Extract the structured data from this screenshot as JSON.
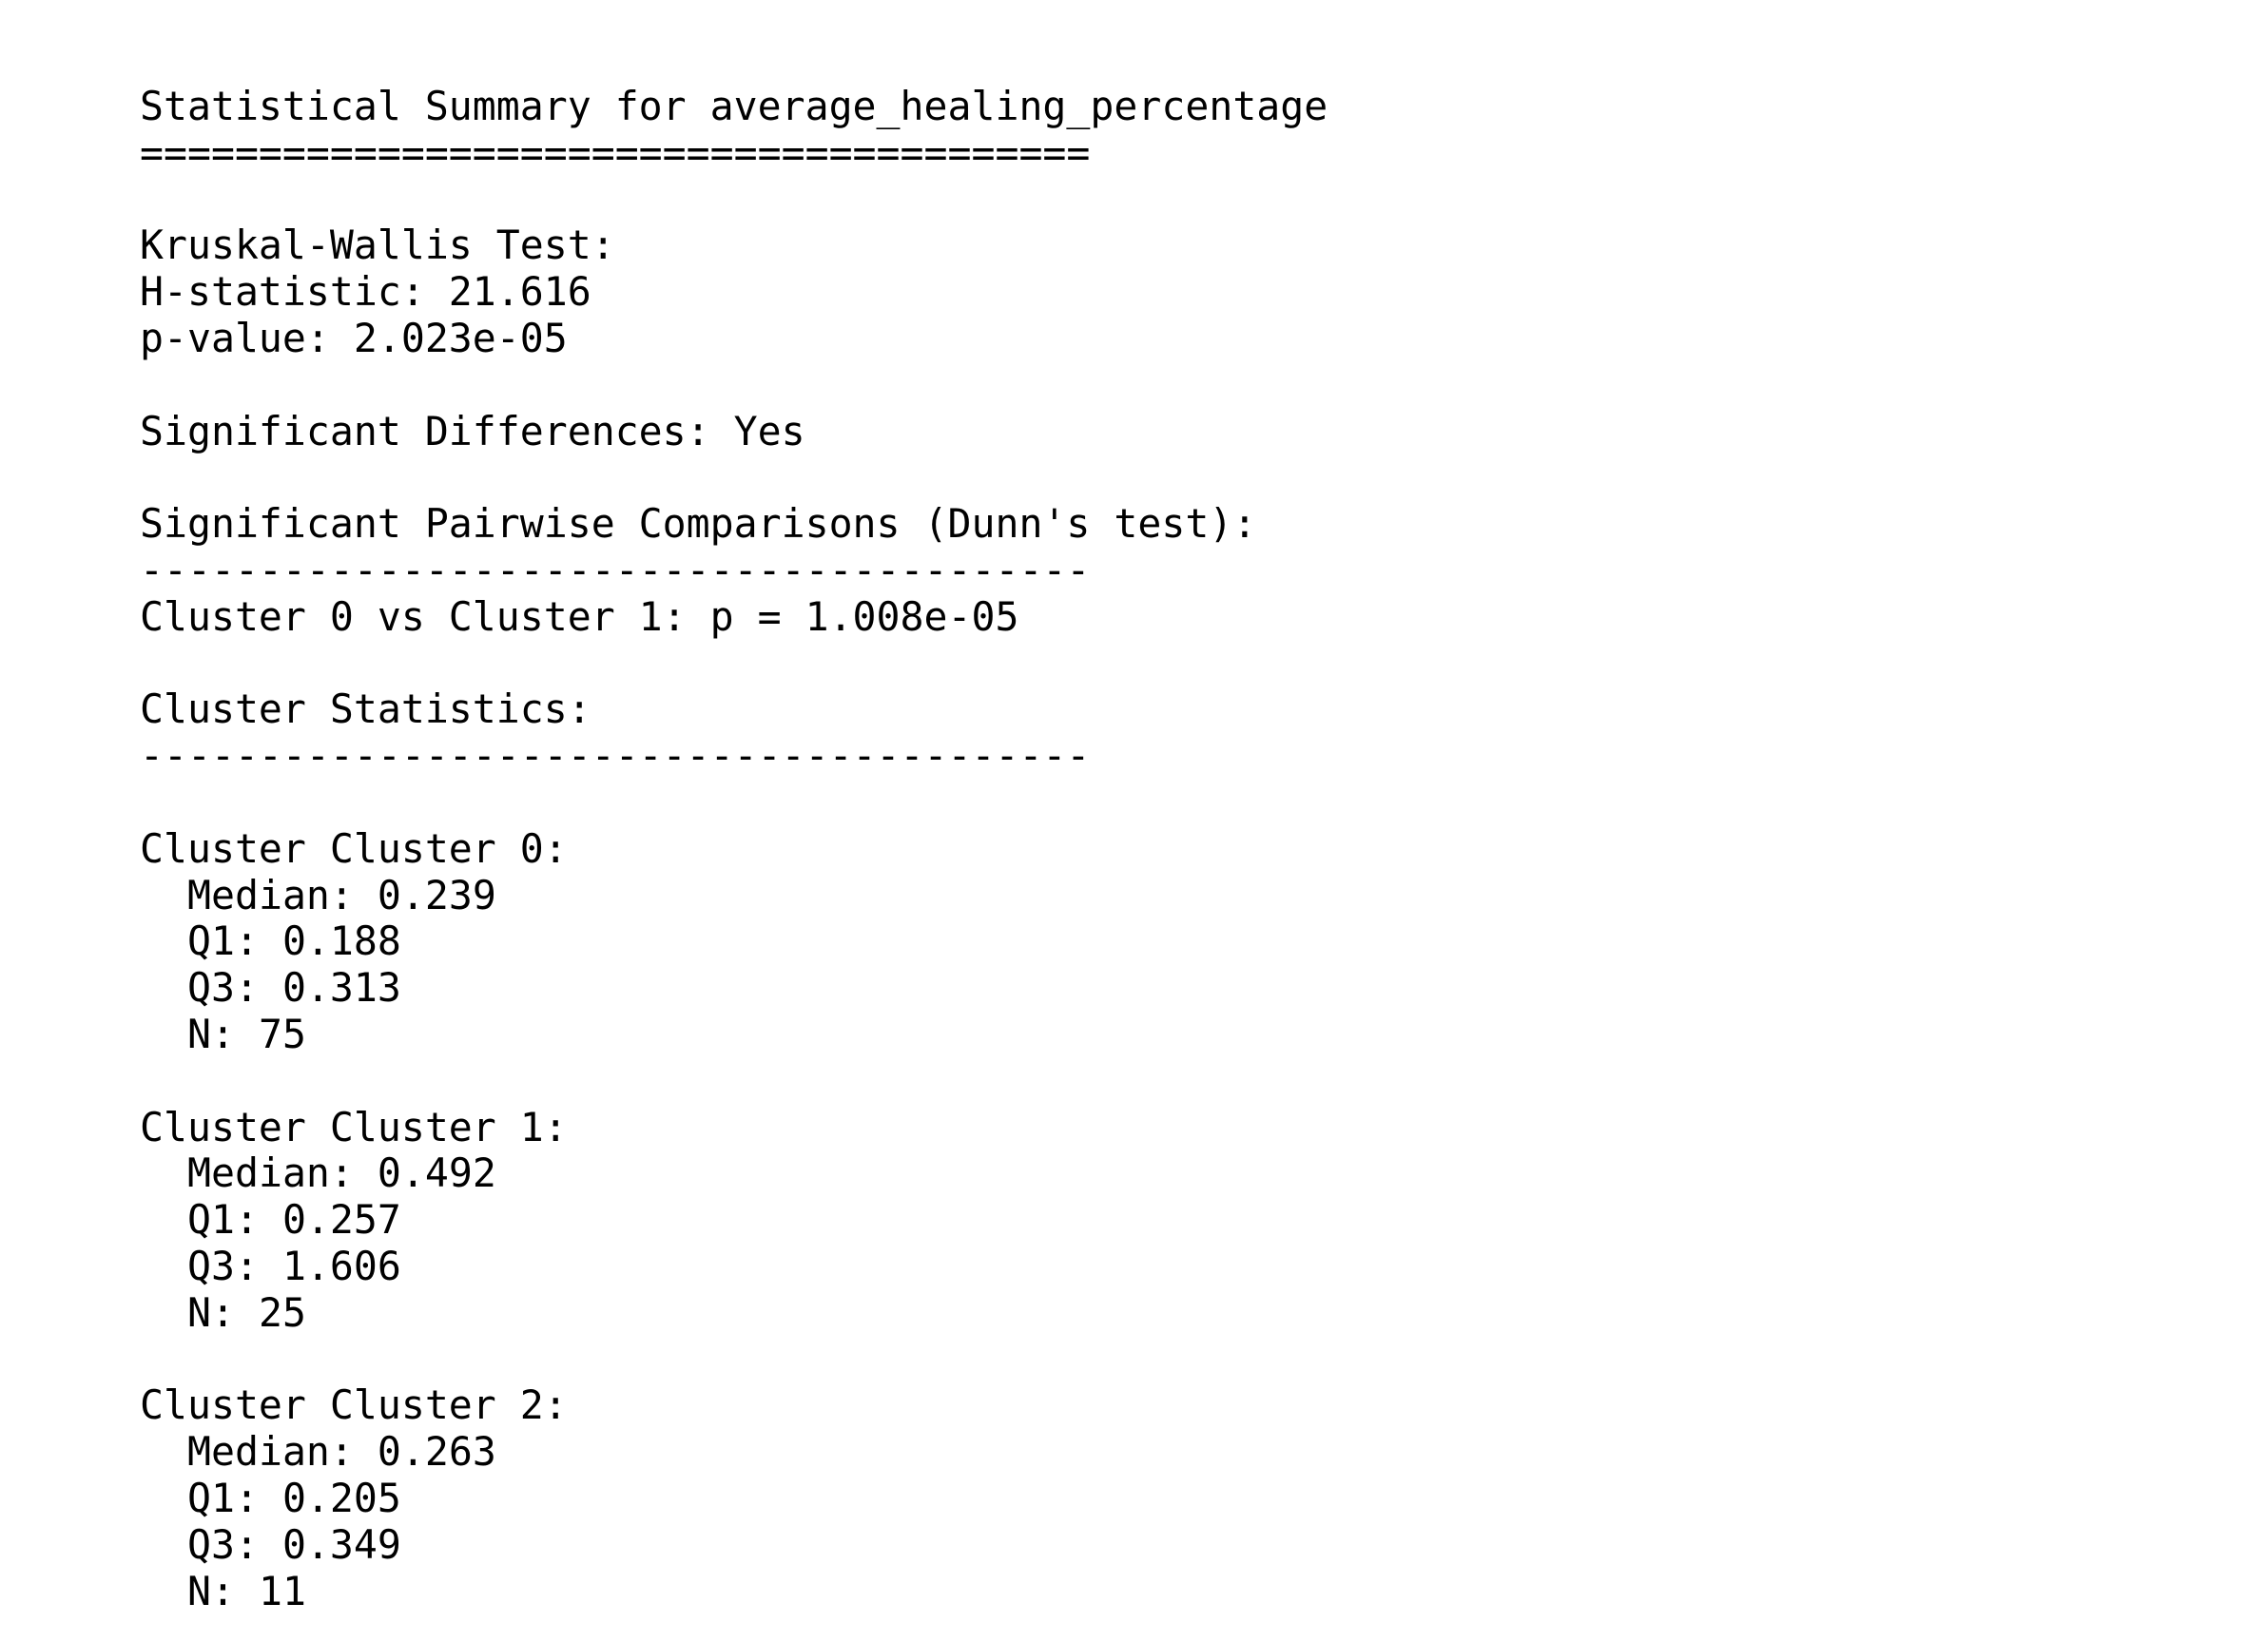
{
  "title": "Statistical Summary for average_healing_percentage",
  "title_rule": "========================================",
  "kruskal_wallis": {
    "heading": "Kruskal-Wallis Test:",
    "h_statistic": "H-statistic: 21.616",
    "p_value": "p-value: 2.023e-05"
  },
  "significance": "Significant Differences: Yes",
  "pairwise": {
    "heading": "Significant Pairwise Comparisons (Dunn's test):",
    "rule": "----------------------------------------",
    "comparisons": [
      "Cluster 0 vs Cluster 1: p = 1.008e-05"
    ]
  },
  "cluster_statistics": {
    "heading": "Cluster Statistics:",
    "rule": "----------------------------------------",
    "clusters": [
      {
        "name": "Cluster Cluster 0:",
        "median": "Median: 0.239",
        "q1": "Q1: 0.188",
        "q3": "Q3: 0.313",
        "n": "N: 75"
      },
      {
        "name": "Cluster Cluster 1:",
        "median": "Median: 0.492",
        "q1": "Q1: 0.257",
        "q3": "Q3: 1.606",
        "n": "N: 25"
      },
      {
        "name": "Cluster Cluster 2:",
        "median": "Median: 0.263",
        "q1": "Q1: 0.205",
        "q3": "Q3: 0.349",
        "n": "N: 11"
      }
    ]
  }
}
